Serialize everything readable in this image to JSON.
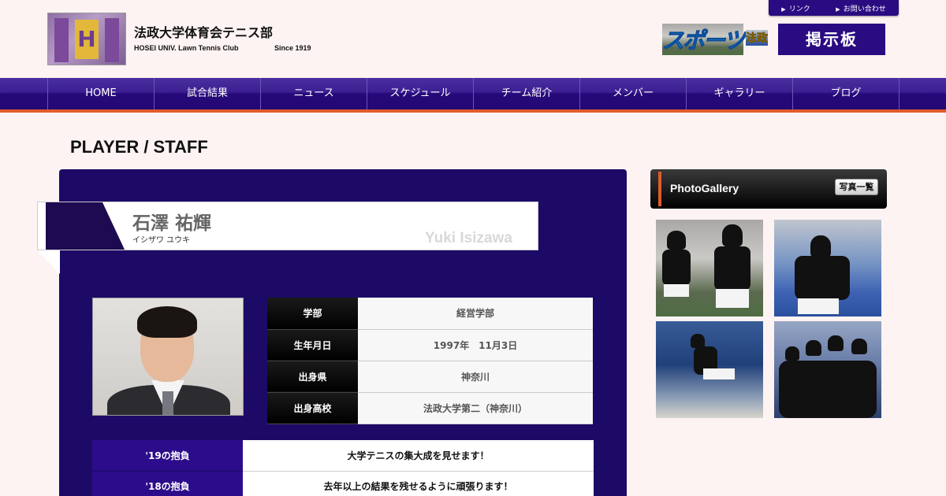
{
  "header": {
    "title": "法政大学体育会テニス部",
    "subtitle": "HOSEI UNIV. Lawn Tennis Club",
    "since": "Since 1919",
    "logo_letter": "H",
    "util_links": [
      {
        "icon": "▶",
        "label": "リンク"
      },
      {
        "icon": "▶",
        "label": "お問い合わせ"
      }
    ],
    "sports_logo_main": "スポーツ",
    "sports_logo_sub": "法政",
    "bbs_label": "掲示板"
  },
  "nav": {
    "items": [
      "HOME",
      "試合結果",
      "ニュース",
      "スケジュール",
      "チーム紹介",
      "メンバー",
      "ギャラリー",
      "ブログ"
    ]
  },
  "page": {
    "heading": "PLAYER / STAFF"
  },
  "player": {
    "name_jp": "石澤 祐輝",
    "name_kana": "イシザワ ユウキ",
    "name_en": "Yuki Isizawa",
    "info": [
      {
        "key": "学部",
        "value": "経営学部"
      },
      {
        "key": "生年月日",
        "value": "1997年　11月3日"
      },
      {
        "key": "出身県",
        "value": "神奈川"
      },
      {
        "key": "出身高校",
        "value": "法政大学第二（神奈川）"
      }
    ],
    "goals": [
      {
        "key": "'19の抱負",
        "value": "大学テニスの集大成を見せます！"
      },
      {
        "key": "'18の抱負",
        "value": "去年以上の結果を残せるように頑張ります！"
      }
    ]
  },
  "sidebar": {
    "gallery_title": "PhotoGallery",
    "gallery_button": "写真一覧"
  },
  "colors": {
    "brand_purple": "#2a0b82",
    "accent_orange": "#e05c2c",
    "page_bg": "#fdf3f2"
  }
}
